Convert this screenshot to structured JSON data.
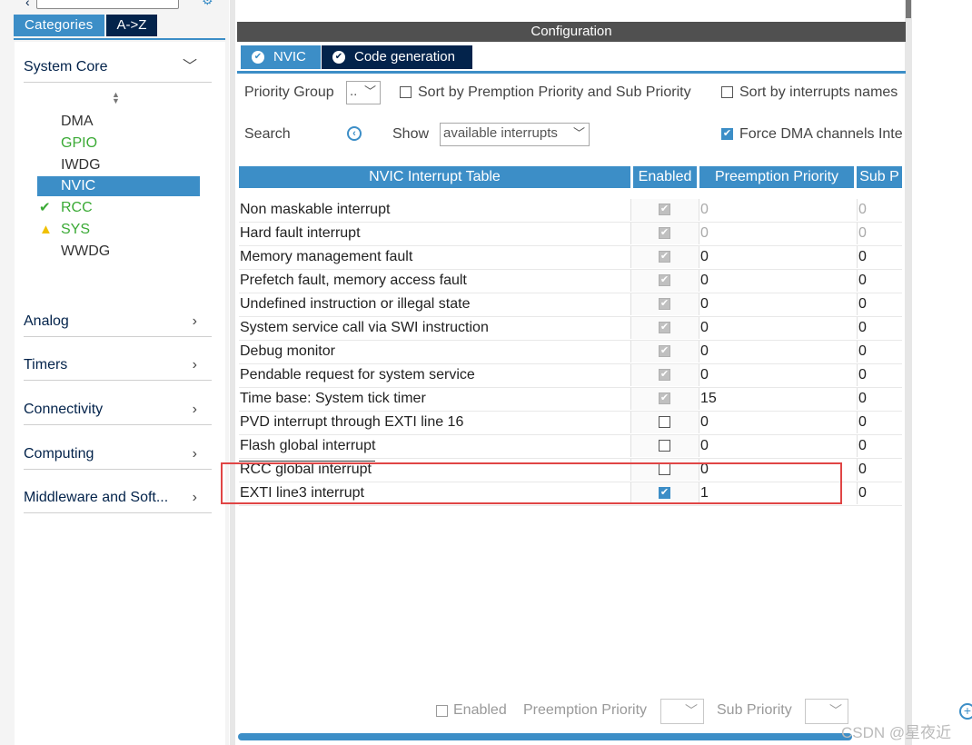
{
  "left_panel": {
    "tabs": [
      {
        "label": "Categories"
      },
      {
        "label": "A->Z"
      }
    ],
    "categories": [
      {
        "label": "System Core",
        "expanded": true
      },
      {
        "label": "Analog"
      },
      {
        "label": "Timers"
      },
      {
        "label": "Connectivity"
      },
      {
        "label": "Computing"
      },
      {
        "label": "Middleware and Soft..."
      }
    ],
    "system_core_items": [
      {
        "label": "DMA",
        "status": "none"
      },
      {
        "label": "GPIO",
        "status": "configured"
      },
      {
        "label": "IWDG",
        "status": "none"
      },
      {
        "label": "NVIC",
        "status": "selected"
      },
      {
        "label": "RCC",
        "status": "ok"
      },
      {
        "label": "SYS",
        "status": "warning"
      },
      {
        "label": "WWDG",
        "status": "none"
      }
    ]
  },
  "config": {
    "header": "Configuration",
    "tabs": [
      {
        "label": "NVIC"
      },
      {
        "label": "Code generation"
      }
    ],
    "priority_group_label": "Priority Group",
    "priority_group_value": "..",
    "sort_premption_label": "Sort by Premption Priority and Sub Priority",
    "sort_names_label": "Sort by interrupts names",
    "search_label": "Search",
    "show_label": "Show",
    "show_value": "available interrupts",
    "force_dma_label": "Force DMA channels Inte",
    "force_dma_checked": true
  },
  "table": {
    "headers": [
      "NVIC Interrupt Table",
      "Enabled",
      "Preemption Priority",
      "Sub P"
    ],
    "rows": [
      {
        "name": "Non maskable interrupt",
        "enabled": true,
        "locked": true,
        "preemption": "0",
        "sub": "0",
        "muted": true
      },
      {
        "name": "Hard fault interrupt",
        "enabled": true,
        "locked": true,
        "preemption": "0",
        "sub": "0",
        "muted": true
      },
      {
        "name": "Memory management fault",
        "enabled": true,
        "locked": true,
        "preemption": "0",
        "sub": "0"
      },
      {
        "name": "Prefetch fault, memory access fault",
        "enabled": true,
        "locked": true,
        "preemption": "0",
        "sub": "0"
      },
      {
        "name": "Undefined instruction or illegal state",
        "enabled": true,
        "locked": true,
        "preemption": "0",
        "sub": "0"
      },
      {
        "name": "System service call via SWI instruction",
        "enabled": true,
        "locked": true,
        "preemption": "0",
        "sub": "0"
      },
      {
        "name": "Debug monitor",
        "enabled": true,
        "locked": true,
        "preemption": "0",
        "sub": "0"
      },
      {
        "name": "Pendable request for system service",
        "enabled": true,
        "locked": true,
        "preemption": "0",
        "sub": "0"
      },
      {
        "name": "Time base: System tick timer",
        "enabled": true,
        "locked": true,
        "preemption": "15",
        "sub": "0"
      },
      {
        "name": "PVD interrupt through EXTI line 16",
        "enabled": false,
        "locked": false,
        "preemption": "0",
        "sub": "0"
      },
      {
        "name": "Flash global interrupt",
        "enabled": false,
        "locked": false,
        "preemption": "0",
        "sub": "0"
      },
      {
        "name": "RCC global interrupt",
        "enabled": false,
        "locked": false,
        "preemption": "0",
        "sub": "0"
      },
      {
        "name": "EXTI line3 interrupt",
        "enabled": true,
        "locked": false,
        "preemption": "1",
        "sub": "0"
      }
    ]
  },
  "bottom": {
    "enabled_label": "Enabled",
    "preemption_label": "Preemption Priority",
    "sub_label": "Sub Priority"
  },
  "watermark": "CSDN @星夜近",
  "colors": {
    "accent": "#3c8ec7",
    "dark_tab": "#03234b",
    "config_header": "#505050",
    "ok_green": "#3aaa35",
    "warning_yellow": "#f0c000",
    "highlight_red": "#e04545"
  }
}
